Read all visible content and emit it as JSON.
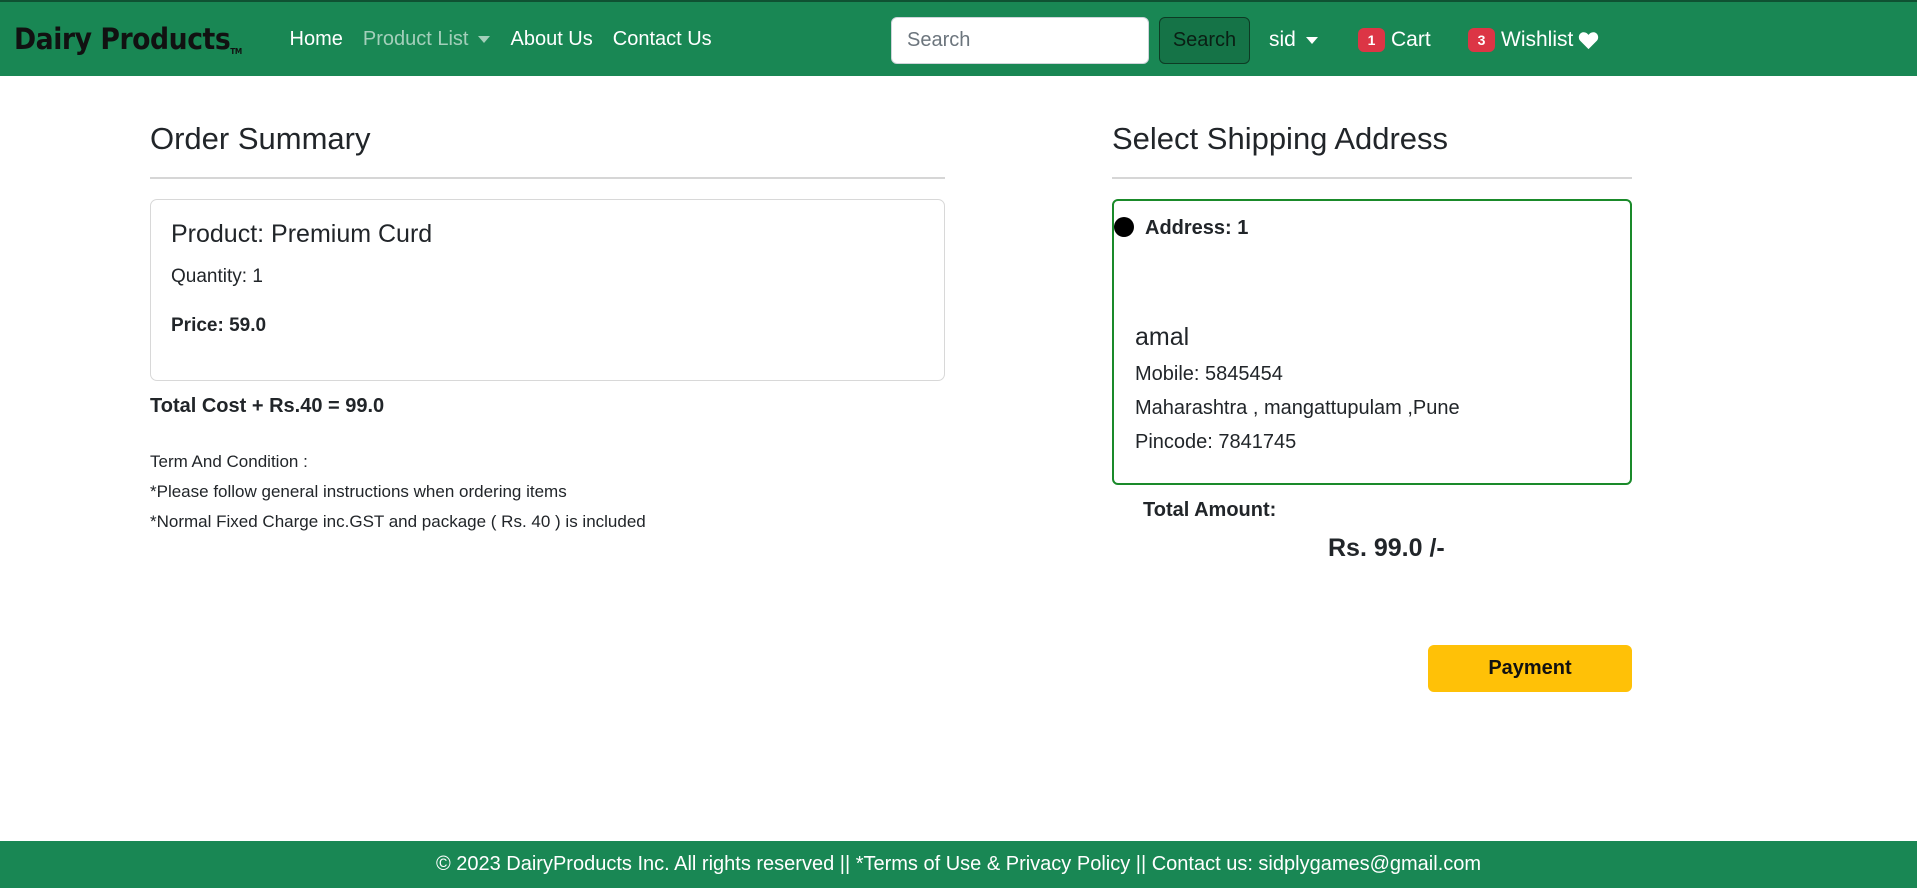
{
  "navbar": {
    "brand": "Dairy Products",
    "brand_tm": "TM",
    "links": {
      "home": "Home",
      "product_list": "Product List",
      "about": "About Us",
      "contact": "Contact Us"
    },
    "search": {
      "placeholder": "Search",
      "button": "Search"
    },
    "user": "sid",
    "cart": {
      "count": "1",
      "label": "Cart"
    },
    "wishlist": {
      "count": "3",
      "label": "Wishlist"
    },
    "colors": {
      "background": "#198754",
      "badge": "#dc3545"
    }
  },
  "order_summary": {
    "title": "Order Summary",
    "product_name": "Product: Premium Curd",
    "quantity": "Quantity: 1",
    "price": "Price: 59.0",
    "total_cost": "Total Cost + Rs.40 = 99.0",
    "terms": {
      "heading": "Term And Condition :",
      "line1": "*Please follow general instructions when ordering items",
      "line2": "*Normal Fixed Charge inc.GST and package ( Rs. 40 ) is included"
    }
  },
  "shipping": {
    "title": "Select Shipping Address",
    "address_label": "Address: 1",
    "name": "amal",
    "mobile": "Mobile: 5845454",
    "address": "Maharashtra , mangattupulam ,Pune",
    "pincode": "Pincode: 7841745",
    "total_amount_label": "Total Amount:",
    "total_amount": "Rs. 99.0 /-",
    "payment_button": "Payment",
    "colors": {
      "card_border": "#1a8a2a",
      "payment_button": "#ffc107"
    }
  },
  "footer": {
    "text": "© 2023 DairyProducts Inc. All rights reserved || *Terms of Use & Privacy Policy || Contact us: sidplygames@gmail.com"
  }
}
